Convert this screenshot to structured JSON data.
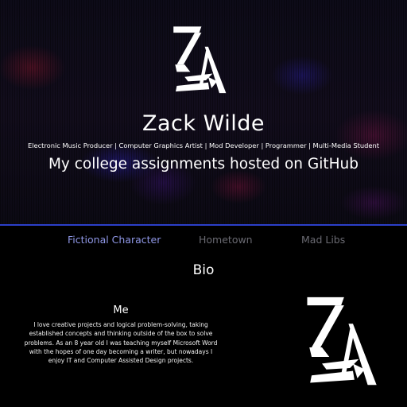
{
  "header": {
    "logo_icon": "za-monogram-logo",
    "name": "Zack Wilde",
    "tagline": "Electronic Music Producer | Computer Graphics Artist | Mod Developer | Programmer | Multi-Media Student",
    "subtitle": "My college assignments hosted on GitHub"
  },
  "nav": {
    "items": [
      {
        "label": "Fictional Character",
        "active": true
      },
      {
        "label": "Hometown",
        "active": false
      },
      {
        "label": "Mad Libs",
        "active": false
      }
    ]
  },
  "main": {
    "section_title": "Bio",
    "bio": {
      "heading": "Me",
      "text": "I love creative projects and logical problem-solving, taking established concepts and thinking outside of the box to solve problems. As an 8 year old I was teaching myself Microsoft Word with the hopes of one day becoming a writer, but nowadays I enjoy IT and Computer Assisted Design projects.",
      "logo_icon": "za-monogram-logo"
    }
  },
  "colors": {
    "background": "#000000",
    "accent_divider": "#2c3fc9",
    "nav_active": "#8f97e6",
    "nav_inactive": "#6a6a72",
    "text": "#ffffff"
  }
}
